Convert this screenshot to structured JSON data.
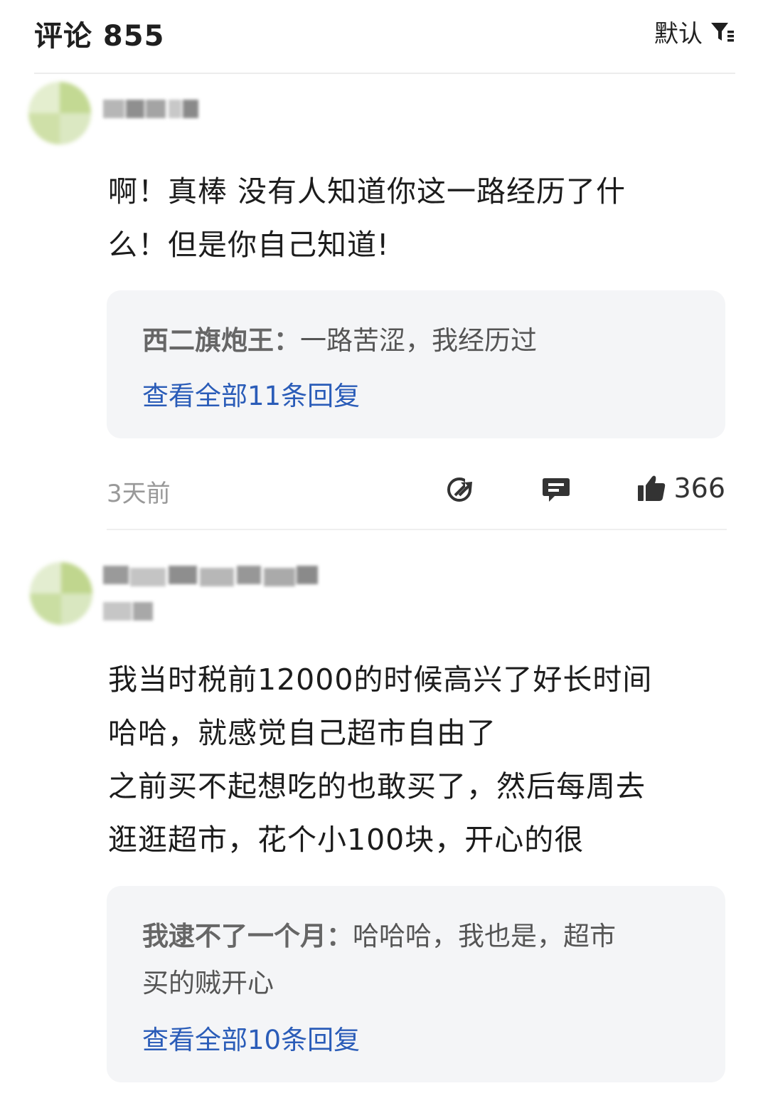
{
  "header": {
    "title": "评论 855",
    "sort_label": "默认",
    "filter_icon": "filter-icon"
  },
  "comments": [
    {
      "avatar_color": "#c9dca0",
      "text": "啊！真棒 没有人知道你这一路经历了什\n么！但是你自己知道!",
      "reply_author": "西二旗炮王：",
      "reply_text": "一路苦涩，我经历过",
      "reply_text_2": "",
      "view_all": "查看全部11条回复",
      "time": "3天前",
      "like_count": "366"
    },
    {
      "avatar_color": "#c6dca0",
      "text": "我当时税前12000的时候高兴了好长时间\n哈哈，就感觉自己超市自由了\n之前买不起想吃的也敢买了，然后每周去\n逛逛超市，花个小100块，开心的很",
      "reply_author": "我逮不了一个月：",
      "reply_text": "哈哈哈，我也是，超市",
      "reply_text_2": "买的贼开心",
      "view_all": "查看全部10条回复"
    }
  ],
  "colors": {
    "link": "#2a5cb8",
    "reply_bg": "#f4f5f7",
    "meta_gray": "#999999"
  }
}
